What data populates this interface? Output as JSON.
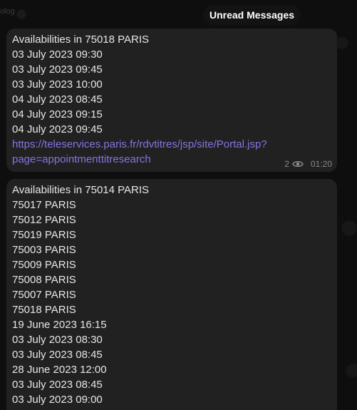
{
  "background": {
    "label": "olog"
  },
  "unread_banner": {
    "label": "Unread Messages"
  },
  "messages": [
    {
      "lines": [
        "Availabilities in 75018 PARIS",
        "03 July 2023 09:30",
        "03 July 2023 09:45",
        "03 July 2023 10:00",
        "04 July 2023 08:45",
        "04 July 2023 09:15",
        "04 July 2023 09:45"
      ],
      "link": {
        "line1": "https://teleservices.paris.fr/rdvtitres/jsp/site/Portal.jsp?",
        "line2": "page=appointmenttitresearch"
      },
      "views": "2",
      "time": "01:20"
    },
    {
      "lines": [
        "Availabilities in 75014 PARIS",
        "75017 PARIS",
        "75012 PARIS",
        "75019 PARIS",
        "75003 PARIS",
        "75009 PARIS",
        "75008 PARIS",
        "75007 PARIS",
        "75018 PARIS",
        "19 June 2023 16:15",
        "03 July 2023 08:30",
        "03 July 2023 08:45",
        "28 June 2023 12:00",
        "03 July 2023 08:45",
        "03 July 2023 09:00"
      ]
    }
  ],
  "icons": {
    "views": "eye-icon"
  },
  "colors": {
    "link": "#8774e1",
    "bubble": "#212121",
    "text": "#e6e6e6",
    "meta": "#8a8a8a"
  }
}
